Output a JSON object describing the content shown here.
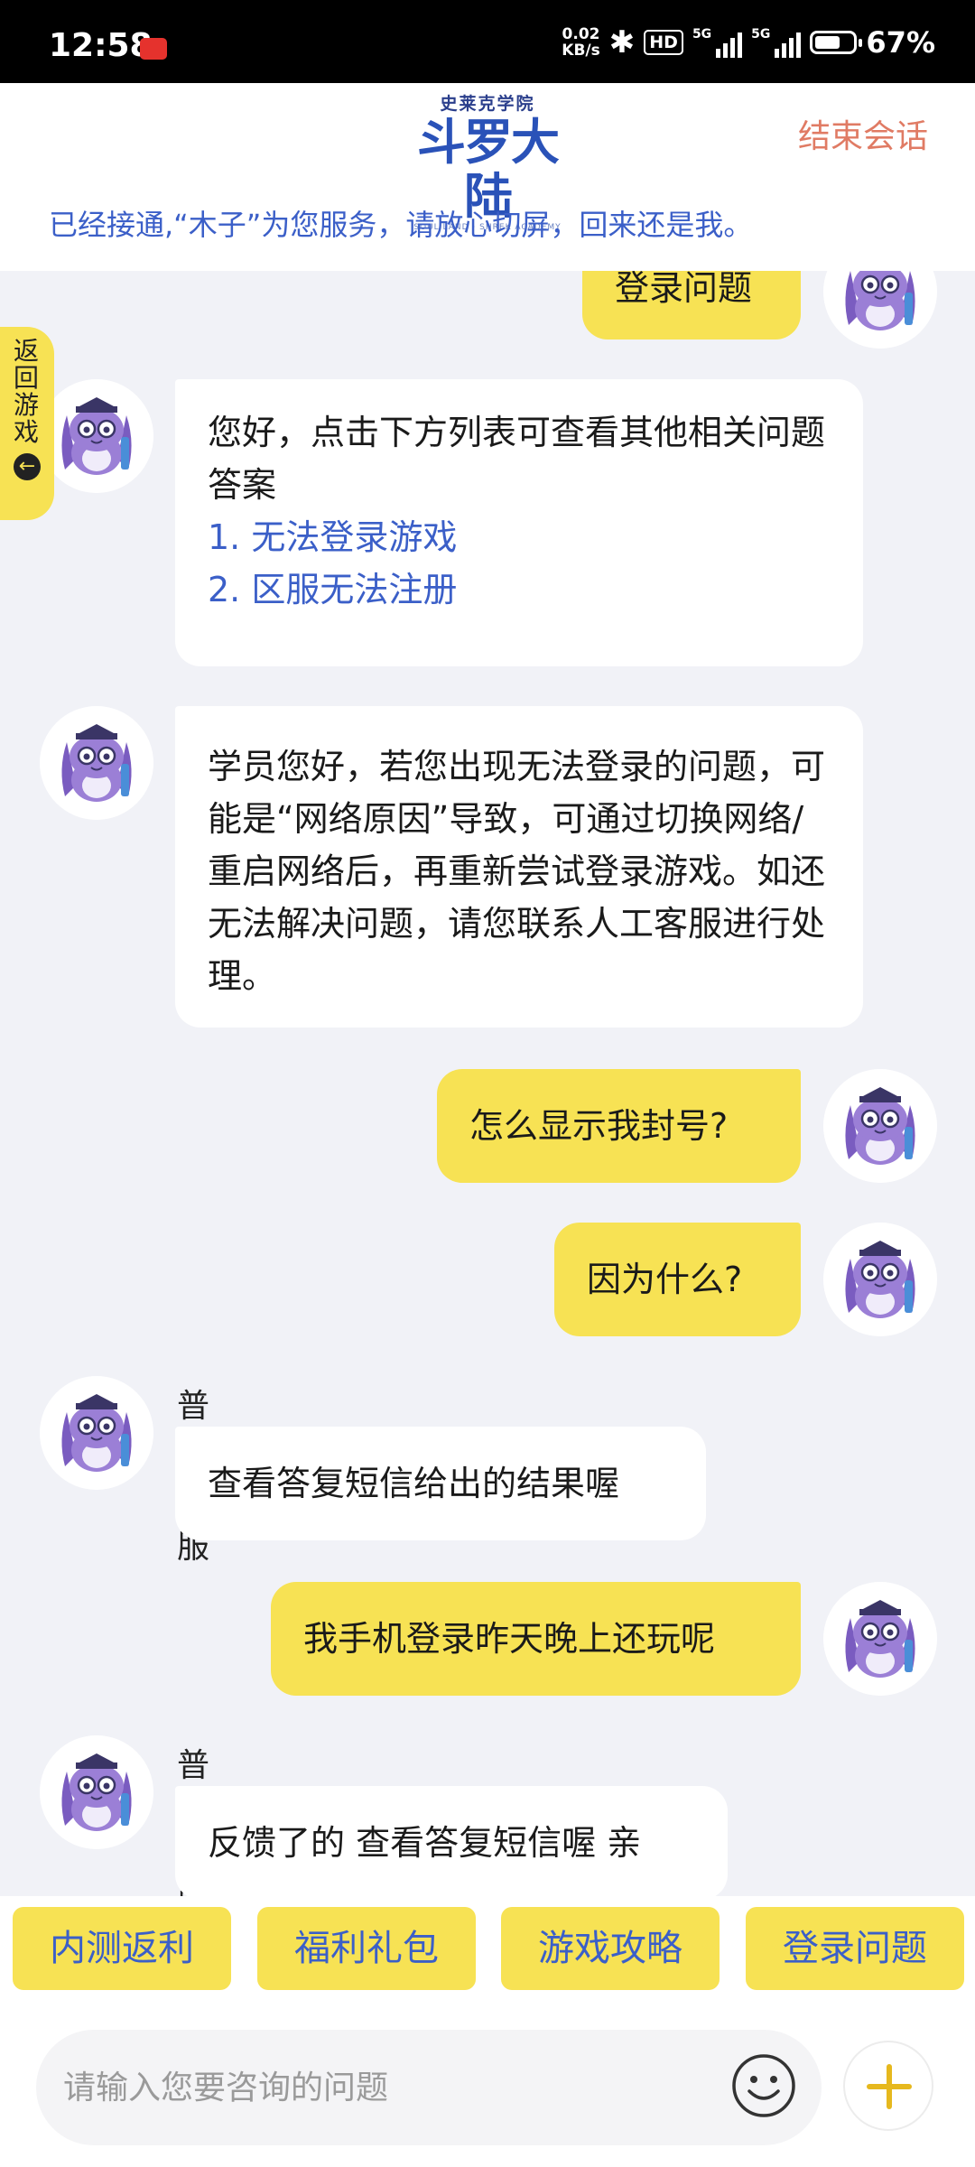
{
  "status": {
    "time": "12:58",
    "speed_top": "0.02",
    "speed_bottom": "KB/s",
    "hd": "HD",
    "net1": "5G",
    "net2": "5G",
    "battery": "67%",
    "battery_fraction": 0.67
  },
  "header": {
    "logo_sub": "史莱克学院",
    "logo_main": "斗罗大陆",
    "logo_en": "SOUL LAND · SHREK ACADEMY",
    "end_label": "结束会话",
    "notice": "已经接通,“木子”为您服务，请放心切屏，回来还是我。"
  },
  "return_tab": {
    "label": "返回游戏",
    "arrow": "←"
  },
  "messages": [
    {
      "side": "user",
      "text": "登录问题"
    },
    {
      "side": "bot",
      "text": "您好，点击下方列表可查看其他相关问题答案",
      "links": [
        "1. 无法登录游戏",
        "2. 区服无法注册"
      ]
    },
    {
      "side": "bot",
      "text": "学员您好，若您出现无法登录的问题，可能是“网络原因”导致，可通过切换网络/重启网络后，再重新尝试登录游戏。如还无法解决问题，请您联系人工客服进行处理。"
    },
    {
      "side": "user",
      "text": "怎么显示我封号?"
    },
    {
      "side": "user",
      "text": "因为什么?"
    },
    {
      "side": "bot",
      "sender": "普通客服",
      "text": "查看答复短信给出的结果喔"
    },
    {
      "side": "user",
      "text": "我手机登录昨天晚上还玩呢"
    },
    {
      "side": "bot",
      "sender": "普通客服",
      "text": "反馈了的 查看答复短信喔 亲"
    }
  ],
  "quick_replies": [
    "内测返利",
    "福利礼包",
    "游戏攻略",
    "登录问题"
  ],
  "input": {
    "placeholder": "请输入您要咨询的问题",
    "value": ""
  },
  "colors": {
    "accent_yellow": "#f7e254",
    "link_blue": "#3b5fc8",
    "end_red": "#e07b64",
    "bg": "#f1f2f7"
  }
}
